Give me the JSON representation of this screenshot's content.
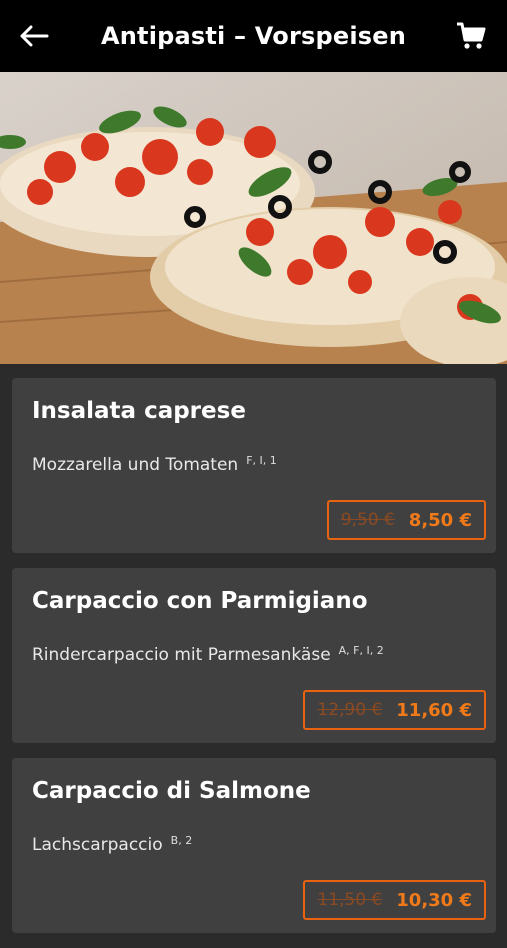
{
  "header": {
    "title": "Antipasti – Vorspeisen",
    "back_icon": "arrow-left-icon",
    "cart_icon": "shopping-cart-icon"
  },
  "hero": {
    "image": "bruschetta-photo"
  },
  "colors": {
    "accent": "#f07a1a",
    "header_bg": "#000000",
    "card_bg": "#404040"
  },
  "items": [
    {
      "name": "Insalata caprese",
      "description": "Mozzarella und Tomaten",
      "allergens": "F, I, 1",
      "old_price": "9,50 €",
      "price": "8,50 €"
    },
    {
      "name": "Carpaccio con Parmigiano",
      "description": "Rindercarpaccio mit Parmesankäse",
      "allergens": "A, F, I, 2",
      "old_price": "12,90 €",
      "price": "11,60 €"
    },
    {
      "name": "Carpaccio di Salmone",
      "description": "Lachscarpaccio",
      "allergens": "B, 2",
      "old_price": "11,50 €",
      "price": "10,30 €"
    }
  ]
}
